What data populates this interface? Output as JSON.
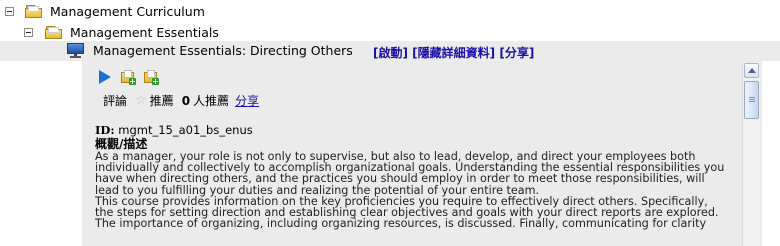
{
  "tree": {
    "level1": {
      "label": "Management Curriculum"
    },
    "level2": {
      "label": "Management Essentials"
    },
    "course": {
      "title": "Management Essentials: Directing Others",
      "actions": [
        "[啟動]",
        "[隱藏詳細資料]",
        "[分享]"
      ]
    }
  },
  "details": {
    "toolbar_icons": [
      "play-icon",
      "add-to-catalog-icon",
      "add-to-plan-icon"
    ],
    "rating": {
      "comment_label": "評論",
      "recommend_label": "推薦",
      "recommend_count": "0",
      "recommend_suffix": "人推薦",
      "share_label": "分享"
    },
    "id_label": "ID:",
    "id_value": "mgmt_15_a01_bs_enus",
    "summary_heading": "概觀/描述",
    "description_lines": [
      "As a manager, your role is not only to supervise, but also to lead, develop, and direct your employees both",
      "individually and collectively to accomplish organizational goals. Understanding the essential responsibilities you",
      "have when directing others, and the practices you should employ in order to meet those responsibilities, will",
      "lead to you fulfilling your duties and realizing the potential of your entire team.",
      "This course provides information on the key proficiencies you require to effectively direct others. Specifically,",
      "the steps for setting direction and establishing clear objectives and goals with your direct reports are explored.",
      "The importance of organizing, including organizing resources, is discussed. Finally, communicating for clarity"
    ]
  },
  "colors": {
    "panel_bg": "#ebebeb",
    "link": "#1a0dab",
    "play": "#1f6fd1"
  }
}
